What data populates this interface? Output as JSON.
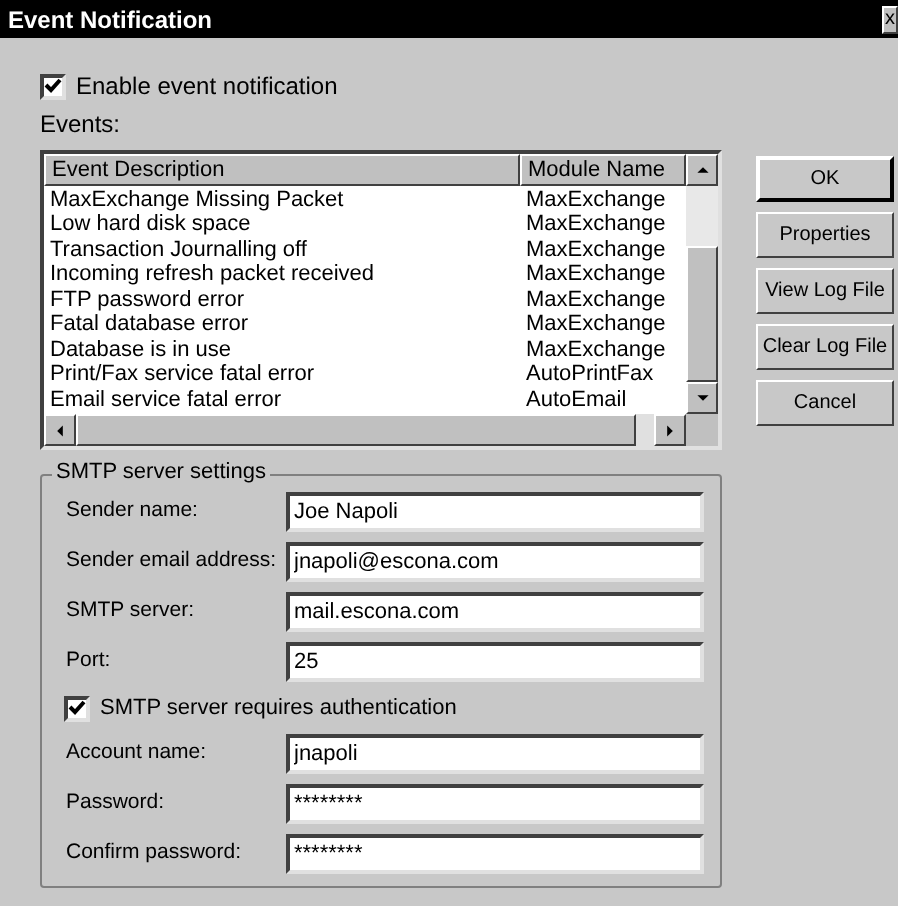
{
  "window": {
    "title": "Event Notification",
    "close": "x"
  },
  "enable_checkbox": {
    "label": "Enable event notification",
    "checked": true
  },
  "events_label": "Events:",
  "events": {
    "columns": [
      "Event Description",
      "Module Name"
    ],
    "rows": [
      [
        "MaxExchange Missing Packet",
        "MaxExchange"
      ],
      [
        "Low hard disk space",
        "MaxExchange"
      ],
      [
        "Transaction Journalling off",
        "MaxExchange"
      ],
      [
        "Incoming refresh packet received",
        "MaxExchange"
      ],
      [
        "FTP password error",
        "MaxExchange"
      ],
      [
        "Fatal database error",
        "MaxExchange"
      ],
      [
        "Database is in use",
        "MaxExchange"
      ],
      [
        "Print/Fax service fatal error",
        "AutoPrintFax"
      ],
      [
        "Email service fatal error",
        "AutoEmail"
      ]
    ]
  },
  "buttons": [
    "OK",
    "Properties",
    "View Log File",
    "Clear Log File",
    "Cancel"
  ],
  "smtp": {
    "title": "SMTP server settings",
    "items": [
      {
        "kind": "field",
        "label": "Sender name:",
        "value": "Joe Napoli"
      },
      {
        "kind": "field",
        "label": "Sender email address:",
        "value": "jnapoli@escona.com"
      },
      {
        "kind": "field",
        "label": "SMTP server:",
        "value": "mail.escona.com"
      },
      {
        "kind": "field",
        "label": "Port:",
        "value": "25"
      },
      {
        "kind": "checkbox",
        "label": "SMTP server requires authentication",
        "checked": true
      },
      {
        "kind": "field",
        "label": "Account name:",
        "value": "jnapoli"
      },
      {
        "kind": "field",
        "label": "Password:",
        "value": "********"
      },
      {
        "kind": "field",
        "label": "Confirm password:",
        "value": "********"
      }
    ]
  }
}
